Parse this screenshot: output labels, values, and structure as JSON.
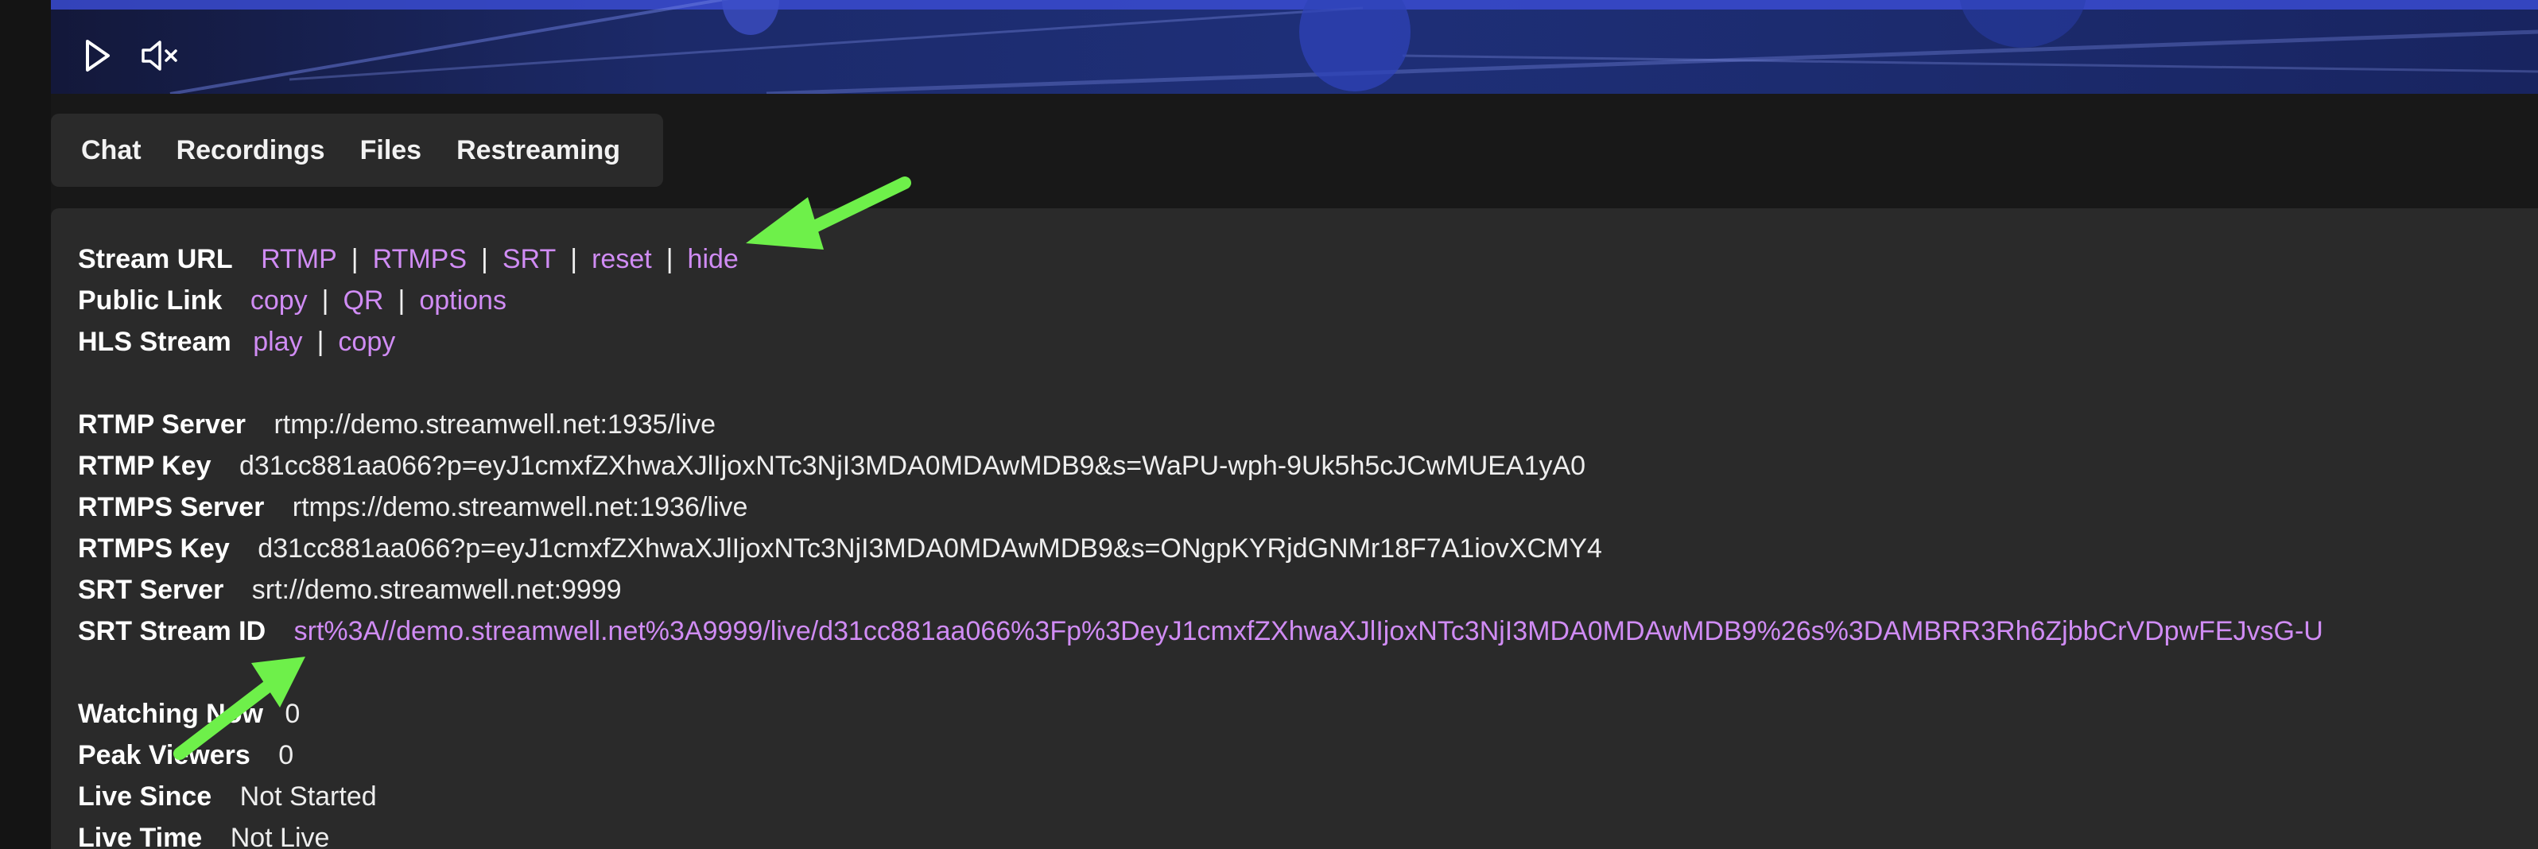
{
  "player": {
    "play_icon": "play-icon",
    "mute_icon": "volume-muted-icon"
  },
  "tabs": [
    {
      "label": "Chat"
    },
    {
      "label": "Recordings"
    },
    {
      "label": "Files"
    },
    {
      "label": "Restreaming"
    }
  ],
  "stream_url": {
    "label": "Stream URL",
    "links": [
      "RTMP",
      "RTMPS",
      "SRT",
      "reset",
      "hide"
    ],
    "separator": "|"
  },
  "public_link": {
    "label": "Public Link",
    "links": [
      "copy",
      "QR",
      "options"
    ]
  },
  "hls_stream": {
    "label": "HLS Stream",
    "links": [
      "play",
      "copy"
    ]
  },
  "details": [
    {
      "label": "RTMP Server",
      "value": "rtmp://demo.streamwell.net:1935/live"
    },
    {
      "label": "RTMP Key",
      "value": "d31cc881aa066?p=eyJ1cmxfZXhwaXJlIjoxNTc3NjI3MDA0MDAwMDB9&s=WaPU-wph-9Uk5h5cJCwMUEA1yA0"
    },
    {
      "label": "RTMPS Server",
      "value": "rtmps://demo.streamwell.net:1936/live"
    },
    {
      "label": "RTMPS Key",
      "value": "d31cc881aa066?p=eyJ1cmxfZXhwaXJlIjoxNTc3NjI3MDA0MDAwMDB9&s=ONgpKYRjdGNMr18F7A1iovXCMY4"
    },
    {
      "label": "SRT Server",
      "value": "srt://demo.streamwell.net:9999"
    }
  ],
  "srt_stream_id": {
    "label": "SRT Stream ID",
    "value": "srt%3A//demo.streamwell.net%3A9999/live/d31cc881aa066%3Fp%3DeyJ1cmxfZXhwaXJlIjoxNTc3NjI3MDA0MDAwMDB9%26s%3DAMBRR3Rh6ZjbbCrVDpwFEJvsG-U"
  },
  "stats": [
    {
      "label": "Watching Now",
      "value": "0"
    },
    {
      "label": "Peak Viewers",
      "value": "0"
    },
    {
      "label": "Live Since",
      "value": "Not Started"
    },
    {
      "label": "Live Time",
      "value": "Not Live"
    }
  ],
  "colors": {
    "link": "#d08cf4",
    "panel": "#2a2a2a",
    "background": "#181818",
    "annotation_arrow": "#6ef04a"
  }
}
